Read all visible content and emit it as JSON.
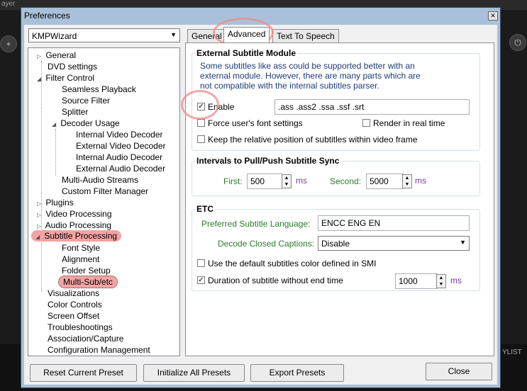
{
  "background": {
    "player_title": "ayer",
    "right_label": "YLIST"
  },
  "dialog": {
    "title": "Preferences",
    "close": "✕"
  },
  "preset": {
    "selected": "KMPWizard"
  },
  "tree": [
    {
      "label": "General",
      "expander": "▷"
    },
    {
      "label": "DVD settings",
      "expander": ""
    },
    {
      "label": "Filter Control",
      "expander": "◢"
    },
    {
      "label": "Seamless Playback",
      "expander": ""
    },
    {
      "label": "Source Filter",
      "expander": ""
    },
    {
      "label": "Splitter",
      "expander": ""
    },
    {
      "label": "Decoder Usage",
      "expander": "◢"
    },
    {
      "label": "Internal Video Decoder",
      "expander": ""
    },
    {
      "label": "External Video Decoder",
      "expander": ""
    },
    {
      "label": "Internal Audio Decoder",
      "expander": ""
    },
    {
      "label": "External Audio Decoder",
      "expander": ""
    },
    {
      "label": "Multi-Audio Streams",
      "expander": ""
    },
    {
      "label": "Custom Filter Manager",
      "expander": ""
    },
    {
      "label": "Plugins",
      "expander": "▷"
    },
    {
      "label": "Video Processing",
      "expander": "▷"
    },
    {
      "label": "Audio Processing",
      "expander": "▷"
    },
    {
      "label": "Subtitle Processing",
      "expander": "◢"
    },
    {
      "label": "Font Style",
      "expander": ""
    },
    {
      "label": "Alignment",
      "expander": ""
    },
    {
      "label": "Folder Setup",
      "expander": ""
    },
    {
      "label": "Multi-Sub/etc",
      "expander": ""
    },
    {
      "label": "Visualizations",
      "expander": ""
    },
    {
      "label": "Color Controls",
      "expander": ""
    },
    {
      "label": "Screen Offset",
      "expander": ""
    },
    {
      "label": "Troubleshootings",
      "expander": ""
    },
    {
      "label": "Association/Capture",
      "expander": ""
    },
    {
      "label": "Configuration Management",
      "expander": ""
    }
  ],
  "tabs": [
    "General",
    "Advanced",
    "Text To Speech"
  ],
  "external": {
    "title": "External Subtitle Module",
    "desc1": "Some subtitles like ass could be supported better with an",
    "desc2": "external module. However, there are many parts which are",
    "desc3": "not compatible with the internal subtitles parser.",
    "enable_label": "Enable",
    "enable_checked": "✓",
    "extensions": ".ass .ass2 .ssa .ssf .srt",
    "force_font": "Force user's font settings",
    "realtime": "Render in real time",
    "keep_position": "Keep the relative position of subtitles within video frame"
  },
  "intervals": {
    "title": "Intervals to Pull/Push Subtitle Sync",
    "first_label": "First:",
    "first_value": "500",
    "first_unit": "ms",
    "second_label": "Second:",
    "second_value": "5000",
    "second_unit": "ms"
  },
  "etc": {
    "title": "ETC",
    "lang_label": "Preferred Subtitle Language:",
    "lang_value": "ENCC ENG EN",
    "cc_label": "Decode Closed Captions:",
    "cc_value": "Disable",
    "default_color": "Use the default subtitles color defined in SMI",
    "duration_label": "Duration of subtitle without end time",
    "duration_checked": "✓",
    "duration_value": "1000",
    "duration_unit": "ms"
  },
  "buttons": {
    "reset": "Reset Current Preset",
    "initialize": "Initialize All Presets",
    "export": "Export Presets",
    "close": "Close"
  },
  "icons": {
    "spin_up": "▲",
    "spin_down": "▼",
    "dropdown": "▼"
  }
}
